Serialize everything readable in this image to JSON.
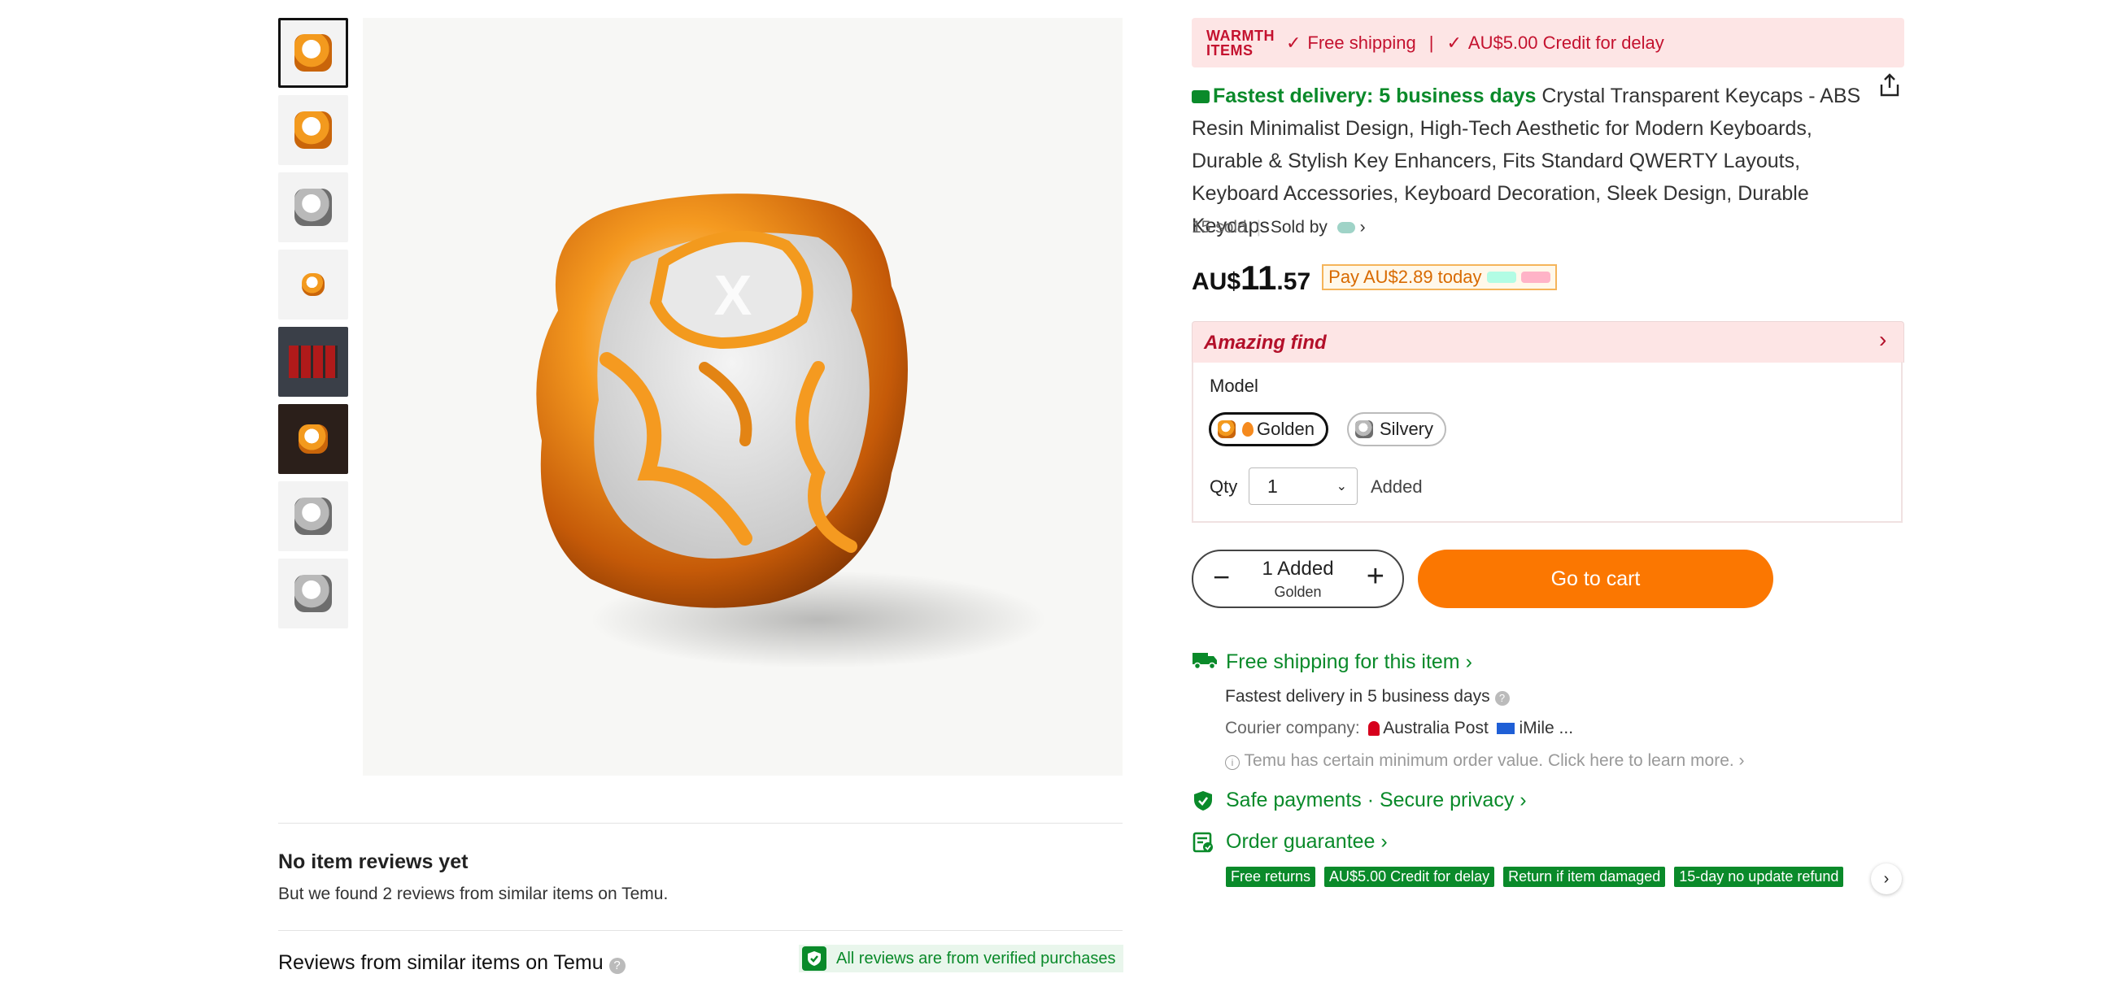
{
  "banner": {
    "brand": "WARMTH ITEMS",
    "brand_line1": "WARMTH",
    "brand_line2": "ITEMS",
    "free_shipping": "Free shipping",
    "credit": "AU$5.00 Credit for delay"
  },
  "product": {
    "fastest": "Fastest delivery: 5 business days",
    "title": "Crystal Transparent Keycaps - ABS Resin Minimalist Design, High-Tech Aesthetic for Modern Keyboards, Durable & Stylish Key Enhancers, Fits Standard QWERTY Layouts, Keyboard Accessories, Keyboard Decoration, Sleek Design, Durable Keycaps",
    "sold": "15 sold",
    "sold_by": "Sold by",
    "price_currency": "AU$",
    "price_int": "11",
    "price_dec": ".57",
    "pay_today": "Pay AU$2.89 today"
  },
  "options": {
    "section_label": "Amazing find",
    "model_label": "Model",
    "models": [
      "Golden",
      "Silvery"
    ],
    "qty_label": "Qty",
    "qty_value": "1",
    "added_label": "Added"
  },
  "cart": {
    "count": "1 Added",
    "variant": "Golden",
    "go_to_cart": "Go to cart"
  },
  "shipping": {
    "title": "Free shipping for this item",
    "fastest": "Fastest delivery in 5 business days",
    "courier_label": "Courier company:",
    "courier1": "Australia Post",
    "courier2": "iMile ...",
    "min_order": "Temu has certain minimum order value. Click here to learn more."
  },
  "safety": {
    "safe": "Safe payments · Secure privacy",
    "guarantee": "Order guarantee",
    "tags": [
      "Free returns",
      "AU$5.00 Credit for delay",
      "Return if item damaged",
      "15-day no update refund"
    ]
  },
  "reviews": {
    "no_reviews": "No item reviews yet",
    "found": "But we found 2 reviews from similar items on Temu.",
    "similar": "Reviews from similar items on Temu",
    "verified": "All reviews are from verified purchases"
  },
  "colors": {
    "accent_orange": "#fb7701",
    "green": "#0a8a2a",
    "red": "#c4122f"
  }
}
